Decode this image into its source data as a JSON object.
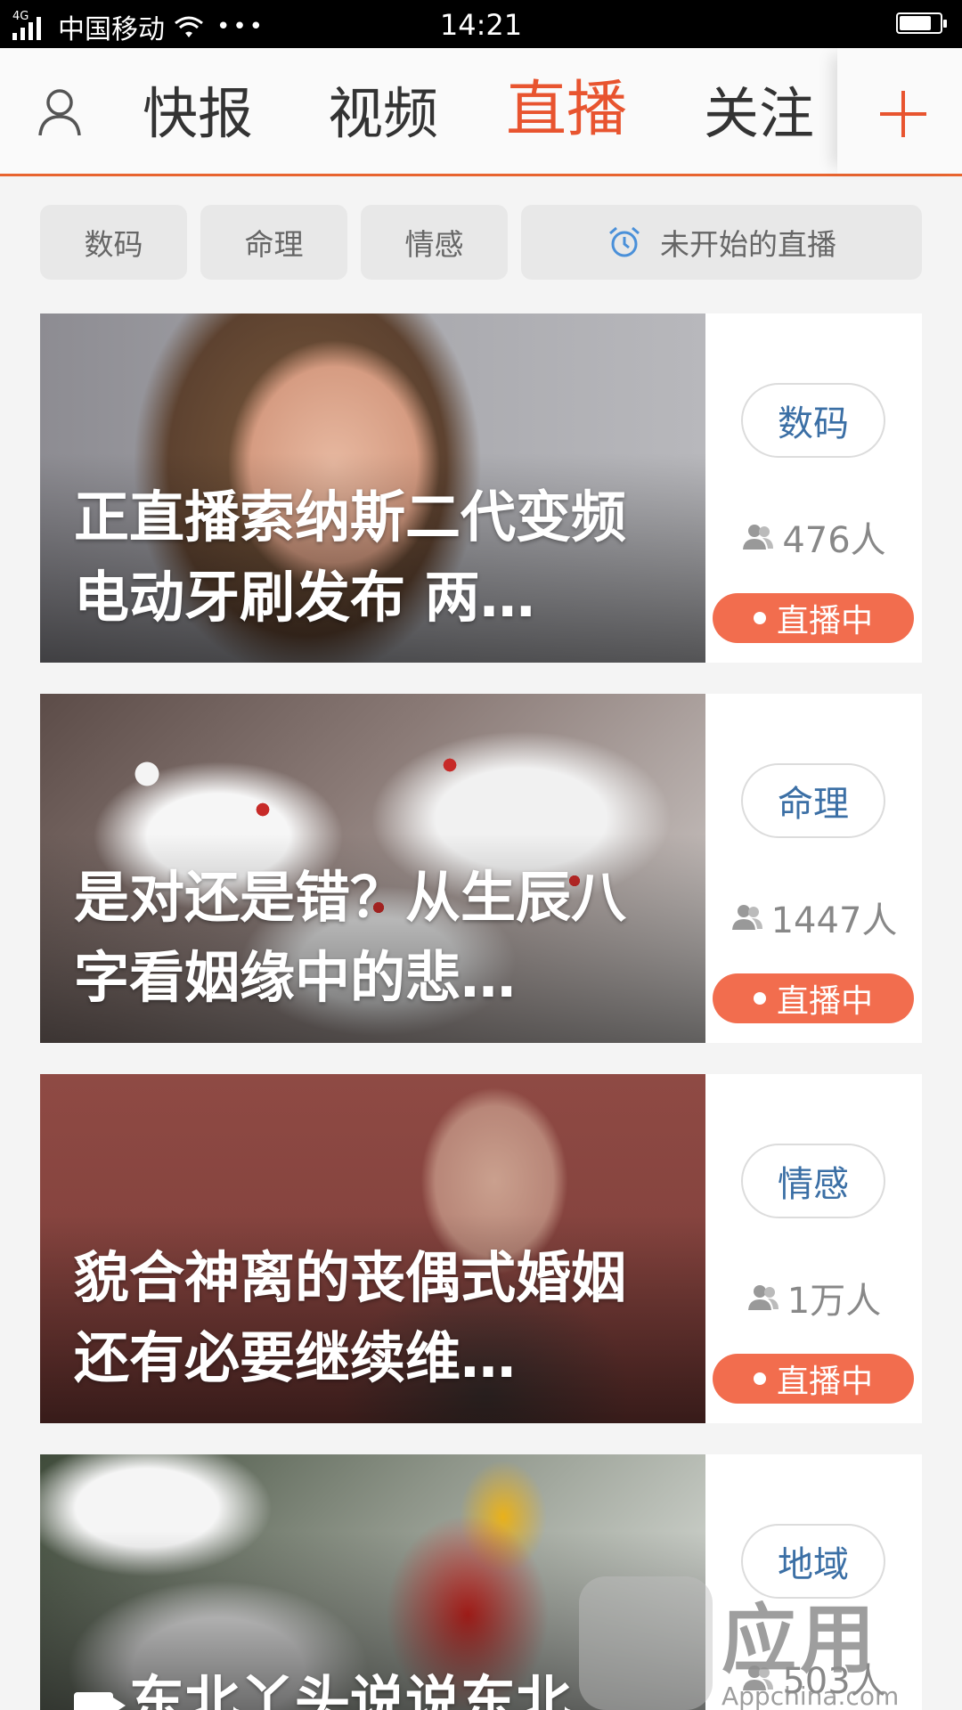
{
  "status_bar": {
    "network_tag": "4G",
    "carrier": "中国移动",
    "dots": "•••",
    "time": "14:21"
  },
  "top_nav": {
    "tabs": [
      {
        "label": "快报",
        "active": false
      },
      {
        "label": "视频",
        "active": false
      },
      {
        "label": "直播",
        "active": true
      },
      {
        "label": "关注",
        "active": false
      }
    ],
    "accent_color": "#e8542f"
  },
  "filters": {
    "chips": [
      "数码",
      "命理",
      "情感"
    ],
    "upcoming_label": "未开始的直播"
  },
  "cards": [
    {
      "title": "正直播索纳斯二代变频电动牙刷发布 两…",
      "category": "数码",
      "viewers": "476人",
      "status": "直播中"
    },
    {
      "title": "是对还是错？从生辰八字看姻缘中的悲…",
      "category": "命理",
      "viewers": "1447人",
      "status": "直播中"
    },
    {
      "title": "貌合神离的丧偶式婚姻 还有必要继续维…",
      "category": "情感",
      "viewers": "1万人",
      "status": "直播中"
    },
    {
      "title": "东北丫头说说东北",
      "category": "地域",
      "viewers": "503人",
      "status": ""
    }
  ],
  "watermark": {
    "brand": "应用汇",
    "url": "Appchina.com"
  }
}
